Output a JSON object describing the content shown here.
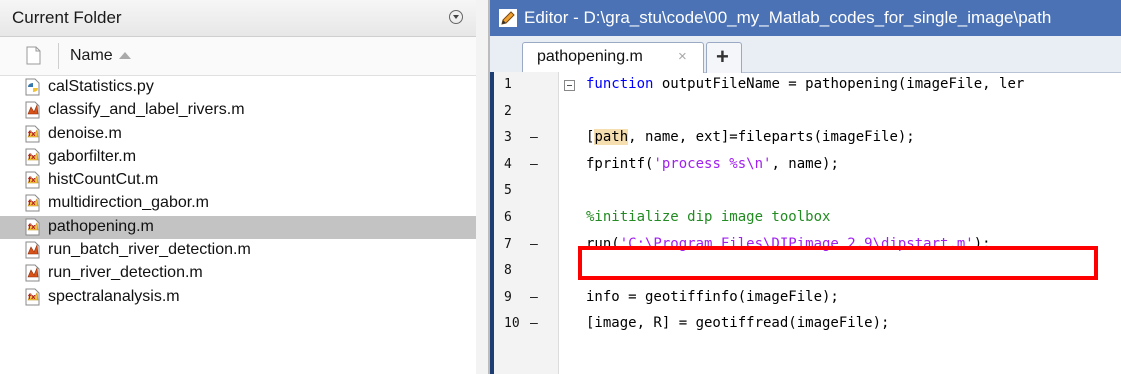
{
  "current_folder": {
    "title": "Current Folder",
    "column_header": "Name",
    "files": [
      {
        "name": "calStatistics.py",
        "icon": "python-file-icon"
      },
      {
        "name": "classify_and_label_rivers.m",
        "icon": "matlab-script-icon"
      },
      {
        "name": "denoise.m",
        "icon": "matlab-function-icon"
      },
      {
        "name": "gaborfilter.m",
        "icon": "matlab-function-icon"
      },
      {
        "name": "histCountCut.m",
        "icon": "matlab-function-icon"
      },
      {
        "name": "multidirection_gabor.m",
        "icon": "matlab-function-icon"
      },
      {
        "name": "pathopening.m",
        "icon": "matlab-function-icon",
        "selected": true
      },
      {
        "name": "run_batch_river_detection.m",
        "icon": "matlab-script-icon"
      },
      {
        "name": "run_river_detection.m",
        "icon": "matlab-script-icon"
      },
      {
        "name": "spectralanalysis.m",
        "icon": "matlab-function-icon"
      }
    ]
  },
  "editor": {
    "title": "Editor - D:\\gra_stu\\code\\00_my_Matlab_codes_for_single_image\\path",
    "tab": {
      "label": "pathopening.m",
      "close": "×"
    },
    "add_tab": "+",
    "lines": [
      {
        "num": "1",
        "mark": "",
        "code": "function outputFileName = pathopening(imageFile, ler"
      },
      {
        "num": "2",
        "mark": "",
        "code": ""
      },
      {
        "num": "3",
        "mark": "–",
        "code": "[path, name, ext]=fileparts(imageFile);"
      },
      {
        "num": "4",
        "mark": "–",
        "code": "fprintf('process %s\\n', name);"
      },
      {
        "num": "5",
        "mark": "",
        "code": ""
      },
      {
        "num": "6",
        "mark": "",
        "code": "%initialize dip image toolbox"
      },
      {
        "num": "7",
        "mark": "–",
        "code": "run('C:\\Program Files\\DIPimage 2.9\\dipstart.m');"
      },
      {
        "num": "8",
        "mark": "",
        "code": ""
      },
      {
        "num": "9",
        "mark": "–",
        "code": "info = geotiffinfo(imageFile);"
      },
      {
        "num": "10",
        "mark": "–",
        "code": "[image, R] = geotiffread(imageFile);"
      }
    ],
    "highlight_color": "#ff0000"
  }
}
